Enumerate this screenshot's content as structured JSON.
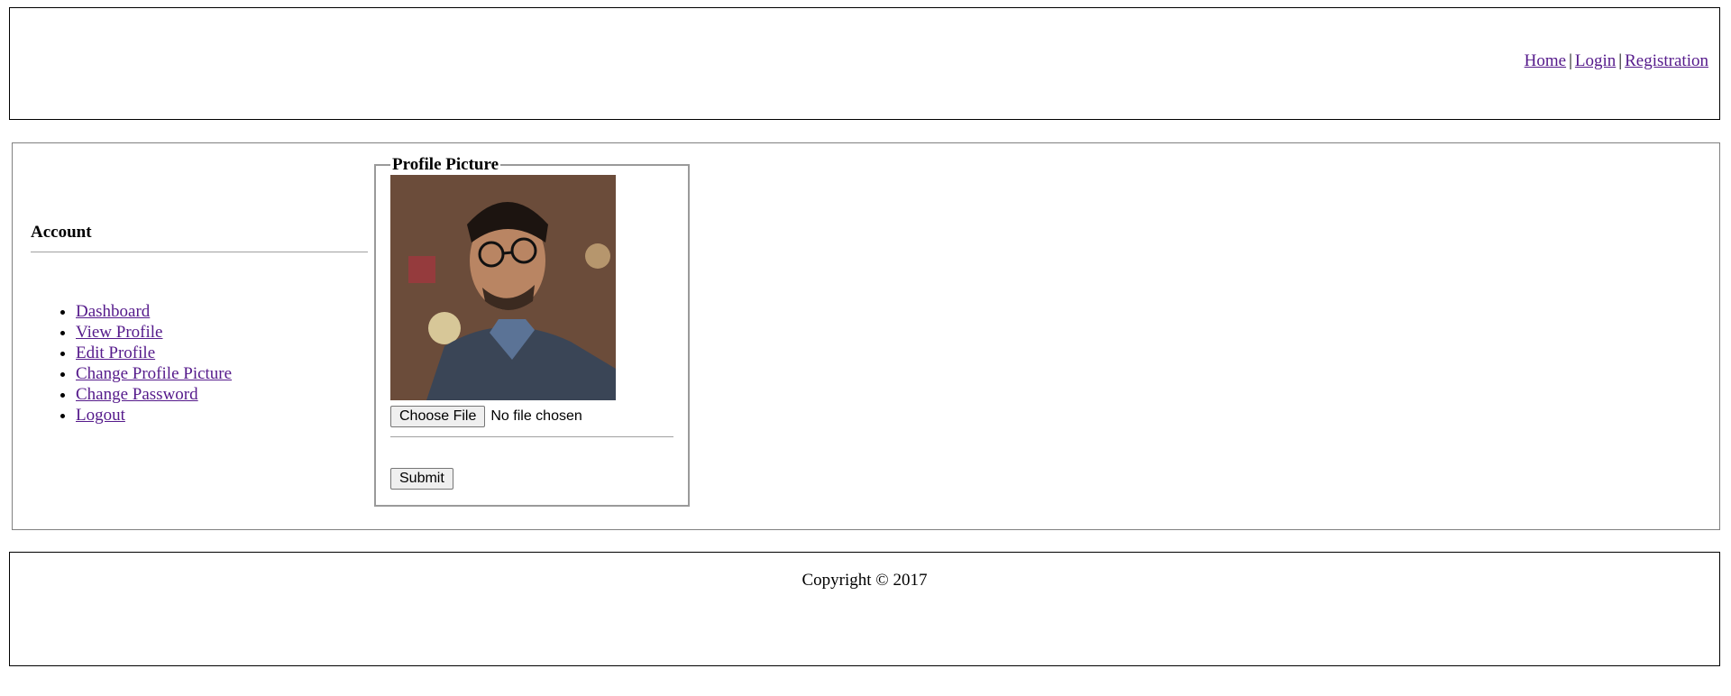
{
  "topnav": {
    "home": "Home",
    "login": "Login",
    "registration": "Registration",
    "separator": "|"
  },
  "sidebar": {
    "title": "Account",
    "items": [
      {
        "label": "Dashboard"
      },
      {
        "label": "View Profile"
      },
      {
        "label": "Edit Profile"
      },
      {
        "label": "Change Profile Picture"
      },
      {
        "label": "Change Password"
      },
      {
        "label": "Logout"
      }
    ]
  },
  "profile_picture": {
    "legend": "Profile Picture",
    "choose_file_label": "Choose File",
    "file_status": "No file chosen",
    "submit_label": "Submit"
  },
  "footer": {
    "copyright": "Copyright © 2017"
  },
  "colors": {
    "link": "#551a8b",
    "border": "#000000"
  }
}
